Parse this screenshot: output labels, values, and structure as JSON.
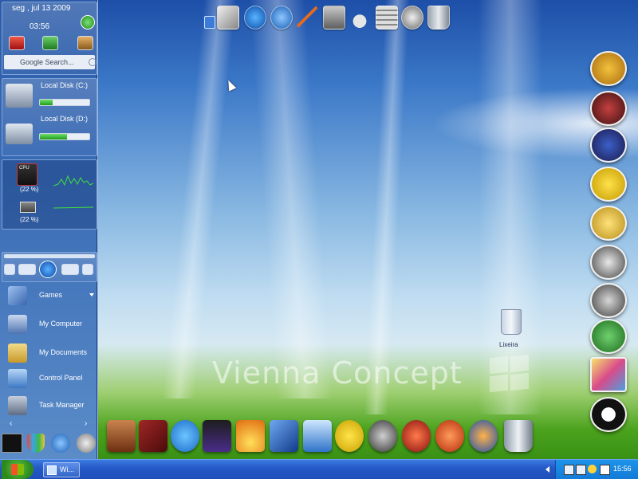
{
  "clock_widget": {
    "date": "seg , jul 13 2009",
    "time": "03:56"
  },
  "search": {
    "placeholder": "Google Search..."
  },
  "drives": [
    {
      "label": "Local Disk (C:)",
      "usage": 0.25
    },
    {
      "label": "Local Disk (D:)",
      "usage": 0.55
    }
  ],
  "system_monitor": {
    "cpu_label": "CPU",
    "cpu_percent": "(22 %)",
    "ram_percent": "(22 %)"
  },
  "start_menu": {
    "items": [
      {
        "label": "Games",
        "icon": "games-icon"
      },
      {
        "label": "My Computer",
        "icon": "computer-icon"
      },
      {
        "label": "My Documents",
        "icon": "folder-icon"
      },
      {
        "label": "Control Panel",
        "icon": "control-panel-icon"
      },
      {
        "label": "Task Manager",
        "icon": "task-manager-icon"
      }
    ]
  },
  "desktop": {
    "watermark": "Vienna Concept",
    "recycle_bin_label": "Lixeira"
  },
  "taskbar": {
    "window_button": "Wi...",
    "clock": "15:56"
  },
  "colors": {
    "accent": "#2659c8",
    "sidebar": "#3a6cb6",
    "progress_green": "#1f9b1c"
  }
}
